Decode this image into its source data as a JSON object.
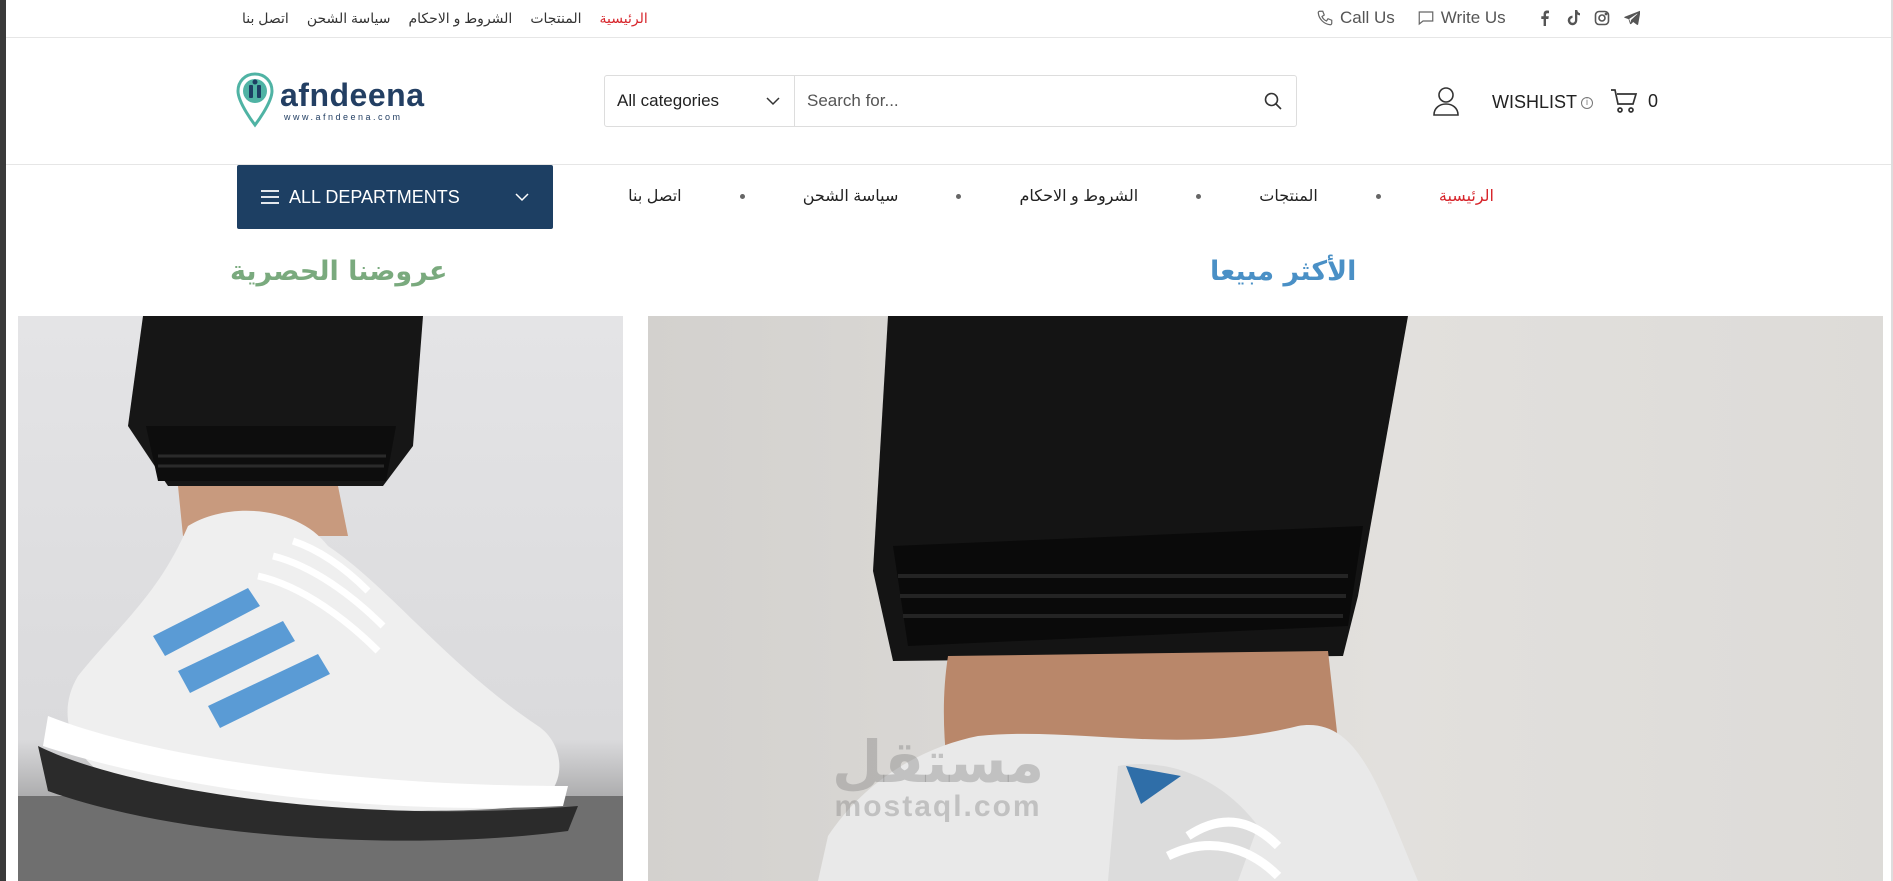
{
  "topbar": {
    "links": [
      {
        "label": "اتصل بنا",
        "active": false
      },
      {
        "label": "سياسة الشحن",
        "active": false
      },
      {
        "label": "الشروط و الاحكام",
        "active": false
      },
      {
        "label": "المنتجات",
        "active": false
      },
      {
        "label": "الرئيسية",
        "active": true
      }
    ],
    "call_label": "Call Us",
    "write_label": "Write Us",
    "social": [
      "facebook-icon",
      "tiktok-icon",
      "instagram-icon",
      "telegram-icon"
    ]
  },
  "header": {
    "logo_name": "afndeena",
    "logo_url": "www.afndeena.com",
    "category_select": "All categories",
    "search_placeholder": "Search for...",
    "wishlist_label": "WISHLIST",
    "cart_count": "0"
  },
  "nav": {
    "departments_label": "ALL DEPARTMENTS",
    "items": [
      {
        "label": "اتصل بنا",
        "active": false
      },
      {
        "label": "سياسة الشحن",
        "active": false
      },
      {
        "label": "الشروط و الاحكام",
        "active": false
      },
      {
        "label": "المنتجات",
        "active": false
      },
      {
        "label": "الرئيسية",
        "active": true
      }
    ]
  },
  "sections": {
    "offers_title": "عروضنا الحصرية",
    "bestseller_title": "الأكثر مبيعا"
  },
  "watermark": {
    "arabic": "مستقل",
    "latin": "mostaql.com"
  },
  "colors": {
    "brand_navy": "#1d3f63",
    "active_red": "#d7262c",
    "offers_green": "#7aaa7e",
    "bestseller_blue": "#4a90c6"
  }
}
